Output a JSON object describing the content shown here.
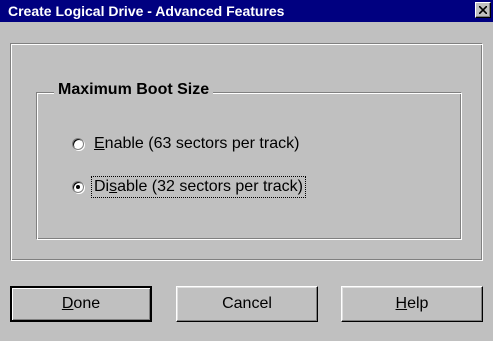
{
  "window": {
    "title": "Create Logical Drive - Advanced Features",
    "close_label": "×"
  },
  "group": {
    "legend": "Maximum Boot Size"
  },
  "options": [
    {
      "mnemonic": "E",
      "rest": "nable (63 sectors per track)",
      "selected": false
    },
    {
      "pre": "Di",
      "mnemonic": "s",
      "rest": "able (32 sectors per track)",
      "selected": true
    }
  ],
  "buttons": {
    "done": {
      "mnemonic": "D",
      "rest": "one"
    },
    "cancel": {
      "label": "Cancel"
    },
    "help": {
      "mnemonic": "H",
      "rest": "elp"
    }
  },
  "colors": {
    "face": "#c0c0c0",
    "titlebar": "#000080",
    "title_text": "#ffffff"
  }
}
